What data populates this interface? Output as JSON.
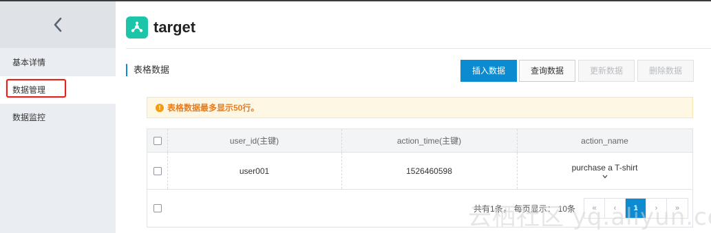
{
  "sidebar": {
    "back_label": "",
    "items": [
      {
        "label": "基本详情"
      },
      {
        "label": "数据管理"
      },
      {
        "label": "数据监控"
      }
    ]
  },
  "header": {
    "title": "target"
  },
  "section": {
    "title": "表格数据"
  },
  "toolbar": {
    "insert": "插入数据",
    "query": "查询数据",
    "update": "更新数据",
    "delete": "删除数据"
  },
  "notice": {
    "icon": "!",
    "text": "表格数据最多显示50行。"
  },
  "table": {
    "columns": [
      "user_id(主键)",
      "action_time(主键)",
      "action_name"
    ],
    "rows": [
      {
        "user_id": "user001",
        "action_time": "1526460598",
        "action_name": "purchase a T-shirt"
      }
    ]
  },
  "pagination": {
    "total_text": "共有1条，",
    "per_page_text": "每页显示：",
    "per_page_value": "10条",
    "first": "«",
    "prev": "‹",
    "current": "1",
    "next": "›",
    "last": "»"
  },
  "watermark": "云栖社区 yq.aliyun.com",
  "colors": {
    "primary": "#0d8bd1",
    "logo": "#1bc6a8",
    "highlight": "#e0201a",
    "notice_text": "#ea7b1b"
  }
}
